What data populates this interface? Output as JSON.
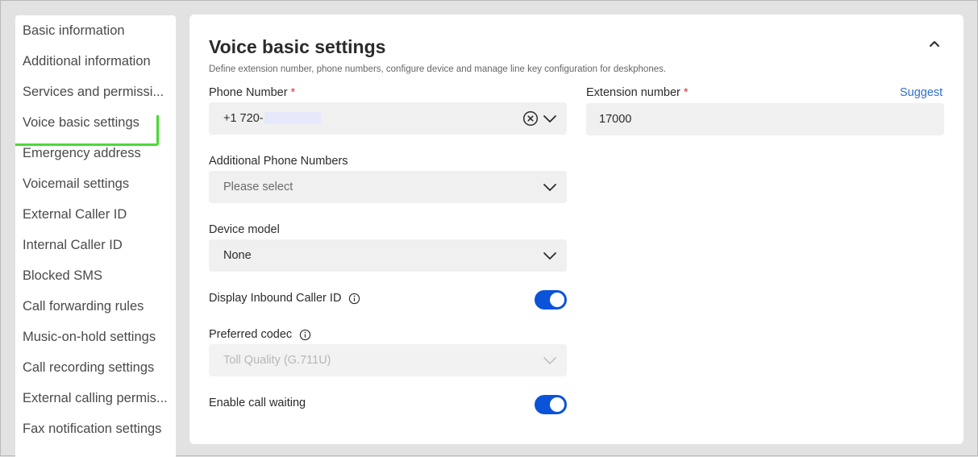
{
  "sidebar": {
    "items": [
      {
        "label": "Basic information"
      },
      {
        "label": "Additional information"
      },
      {
        "label": "Services and permissi..."
      },
      {
        "label": "Voice basic settings"
      },
      {
        "label": "Emergency address"
      },
      {
        "label": "Voicemail settings"
      },
      {
        "label": "External Caller ID"
      },
      {
        "label": "Internal Caller ID"
      },
      {
        "label": "Blocked SMS"
      },
      {
        "label": "Call forwarding rules"
      },
      {
        "label": "Music-on-hold settings"
      },
      {
        "label": "Call recording settings"
      },
      {
        "label": "External calling permis..."
      },
      {
        "label": "Fax notification settings"
      }
    ],
    "active_index": 3,
    "highlight_color": "#4cd83a"
  },
  "section": {
    "title": "Voice basic settings",
    "description": "Define extension number, phone numbers, configure device and manage line key configuration for deskphones.",
    "collapse_icon": "chevron-up-icon"
  },
  "phone_number": {
    "label": "Phone Number",
    "required_mark": "*",
    "value_prefix": "+1 720-",
    "clear_icon": "clear-circle-icon",
    "dropdown_icon": "chevron-down-icon"
  },
  "extension_number": {
    "label": "Extension number",
    "required_mark": "*",
    "value": "17000",
    "suggest_label": "Suggest"
  },
  "additional_numbers": {
    "label": "Additional Phone Numbers",
    "placeholder": "Please select"
  },
  "device_model": {
    "label": "Device model",
    "value": "None"
  },
  "display_inbound_caller_id": {
    "label": "Display Inbound Caller ID",
    "enabled": true
  },
  "preferred_codec": {
    "label": "Preferred codec",
    "value": "Toll Quality (G.711U)",
    "disabled": true
  },
  "call_waiting": {
    "label": "Enable call waiting",
    "enabled": true
  },
  "colors": {
    "accent": "#0b53d8",
    "link": "#2f6fcf",
    "required": "#dd3333"
  }
}
